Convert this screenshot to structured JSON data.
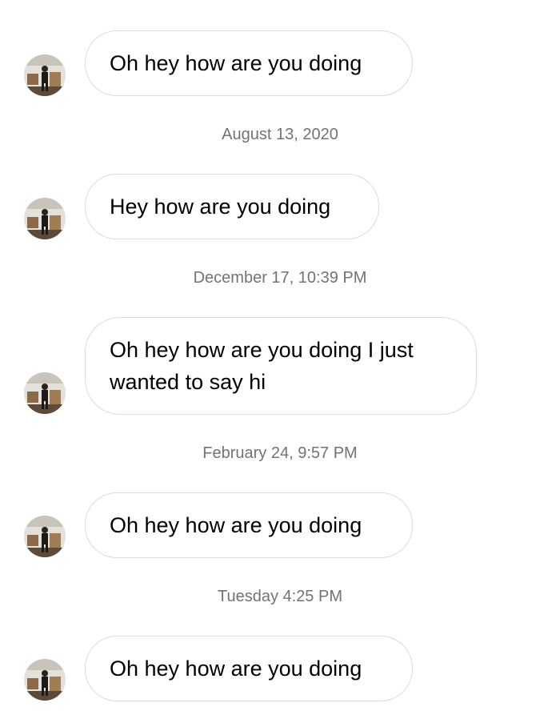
{
  "messages": [
    {
      "text": "Oh hey how are you doing"
    },
    {
      "text": "Hey how are you doing"
    },
    {
      "text": "Oh hey how are you doing I just wanted to say hi"
    },
    {
      "text": "Oh hey how are you doing"
    },
    {
      "text": "Oh hey how are you doing"
    }
  ],
  "timestamps": [
    "August 13, 2020",
    "December 17, 10:39 PM",
    "February 24, 9:57 PM",
    "Tuesday 4:25 PM"
  ],
  "avatar": {
    "icon": "profile-photo-avatar"
  },
  "colors": {
    "bubble_border": "#dbdbdb",
    "timestamp_text": "#737373",
    "background": "#ffffff"
  }
}
